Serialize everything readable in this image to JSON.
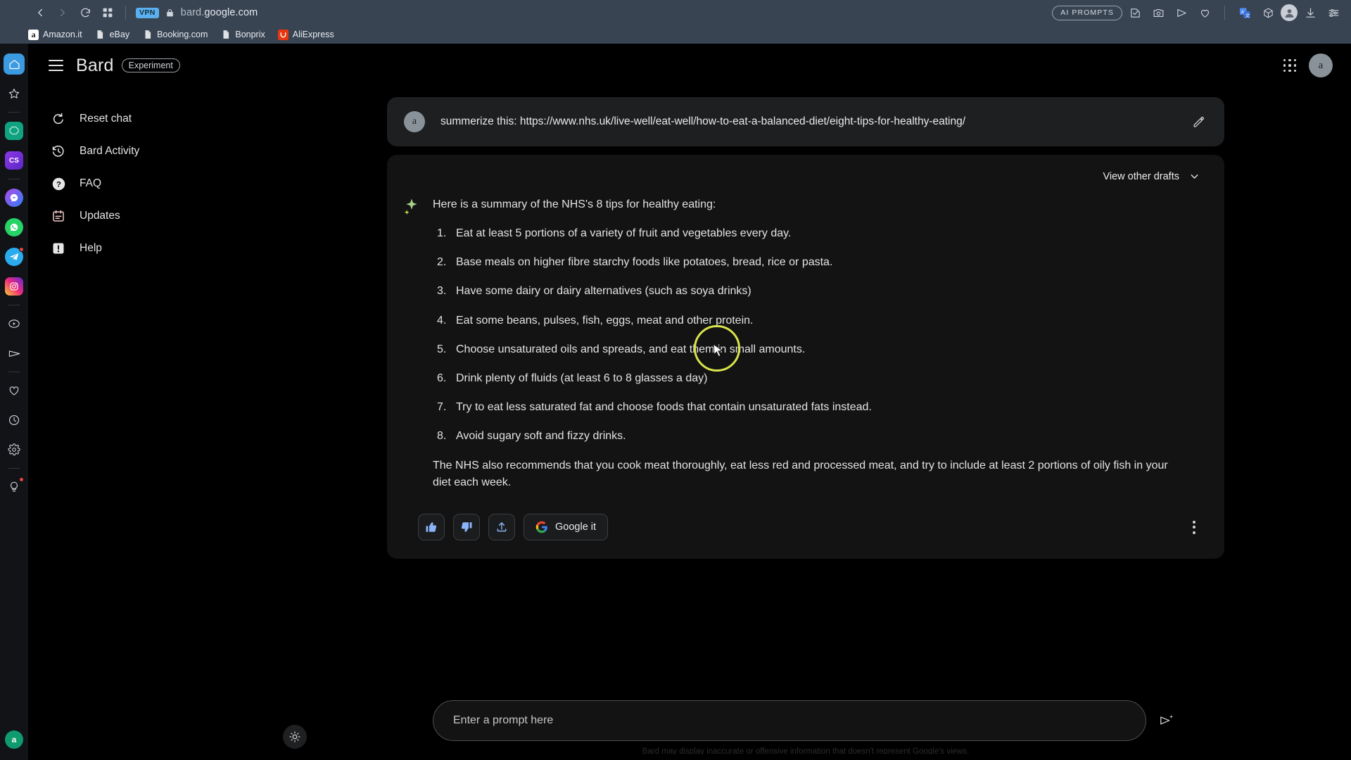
{
  "browser": {
    "back_label": "Back",
    "forward_label": "Forward",
    "reload_label": "Reload",
    "tabs_label": "Tab search",
    "vpn_badge": "VPN",
    "lock_label": "Secure",
    "url_prefix": "bard.",
    "url_main": "google.com",
    "url_full": "bard.google.com",
    "right_icons": [
      {
        "name": "ai-prompts-pill",
        "label": "AI PROMPTS"
      },
      {
        "name": "annotate-icon",
        "label": "Annotate"
      },
      {
        "name": "screenshot-icon",
        "label": "Screenshot"
      },
      {
        "name": "send-icon",
        "label": "Send"
      },
      {
        "name": "favorite-heart-icon",
        "label": "Favorite"
      },
      {
        "name": "translate-icon",
        "label": "Translate"
      },
      {
        "name": "extensions-cube-icon",
        "label": "Extensions"
      },
      {
        "name": "profile-avatar",
        "label": "Profile"
      },
      {
        "name": "download-icon",
        "label": "Downloads"
      },
      {
        "name": "settings-sliders-icon",
        "label": "Settings"
      }
    ],
    "bookmarks": [
      {
        "label": "Amazon.it",
        "icon": "amazon-icon"
      },
      {
        "label": "eBay",
        "icon": "page-icon"
      },
      {
        "label": "Booking.com",
        "icon": "page-icon"
      },
      {
        "label": "Bonprix",
        "icon": "page-icon"
      },
      {
        "label": "AliExpress",
        "icon": "aliexpress-icon"
      }
    ]
  },
  "rail": {
    "items": [
      {
        "name": "home-icon",
        "label": "Home",
        "active": true
      },
      {
        "name": "favorites-star-icon",
        "label": "Favorites"
      },
      {
        "name": "chatgpt-icon",
        "label": "ChatGPT",
        "text": ""
      },
      {
        "name": "cs-icon",
        "label": "CS",
        "text": "CS"
      },
      {
        "name": "messenger-icon",
        "label": "Messenger"
      },
      {
        "name": "whatsapp-icon",
        "label": "WhatsApp"
      },
      {
        "name": "telegram-icon",
        "label": "Telegram",
        "badge": true
      },
      {
        "name": "instagram-icon",
        "label": "Instagram"
      },
      {
        "name": "video-player-icon",
        "label": "Video"
      },
      {
        "name": "send-plane-icon",
        "label": "Send"
      },
      {
        "name": "heart-icon",
        "label": "Saved"
      },
      {
        "name": "history-clock-icon",
        "label": "History"
      },
      {
        "name": "settings-gear-icon",
        "label": "Settings"
      },
      {
        "name": "ideas-bulb-icon",
        "label": "Ideas",
        "badge": true
      },
      {
        "name": "account-a-icon",
        "label": "Account",
        "text": "a"
      }
    ]
  },
  "app": {
    "menu_label": "Main menu",
    "brand": "Bard",
    "experiment_chip": "Experiment",
    "apps_grid_label": "Google apps",
    "avatar_letter": "a",
    "nav": [
      {
        "label": "Reset chat",
        "icon": "reset-icon"
      },
      {
        "label": "Bard Activity",
        "icon": "history-icon"
      },
      {
        "label": "FAQ",
        "icon": "faq-icon"
      },
      {
        "label": "Updates",
        "icon": "calendar-icon"
      },
      {
        "label": "Help",
        "icon": "help-alert-icon"
      }
    ]
  },
  "conversation": {
    "user_avatar_letter": "a",
    "query": "summerize this: https://www.nhs.uk/live-well/eat-well/how-to-eat-a-balanced-diet/eight-tips-for-healthy-eating/",
    "edit_label": "Edit prompt",
    "drafts_label": "View other drafts",
    "answer_intro": "Here is a summary of the NHS's 8 tips for healthy eating:",
    "answer_tips": [
      "Eat at least 5 portions of a variety of fruit and vegetables every day.",
      "Base meals on higher fibre starchy foods like potatoes, bread, rice or pasta.",
      "Have some dairy or dairy alternatives (such as soya drinks)",
      "Eat some beans, pulses, fish, eggs, meat and other protein.",
      "Choose unsaturated oils and spreads, and eat them in small amounts.",
      "Drink plenty of fluids (at least 6 to 8 glasses a day)",
      "Try to eat less saturated fat and choose foods that contain unsaturated fats instead.",
      "Avoid sugary soft and fizzy drinks."
    ],
    "answer_outro": "The NHS also recommends that you cook meat thoroughly, eat less red and processed meat, and try to include at least 2 portions of oily fish in your diet each week.",
    "actions": {
      "thumbs_up_label": "Good response",
      "thumbs_down_label": "Bad response",
      "share_label": "Share & export",
      "google_it_label": "Google it",
      "more_label": "More options"
    }
  },
  "composer": {
    "placeholder": "Enter a prompt here",
    "value": "",
    "send_label": "Submit",
    "disclaimer": "Bard may display inaccurate or offensive information that doesn't represent Google's views."
  },
  "theme": {
    "toggle_label": "Use light theme",
    "accent_blue": "#8ab4f8",
    "highlight_yellow": "#d8e44a",
    "chrome_bg": "#394452",
    "app_bg": "#000000",
    "card_bg": "#1e1f20"
  }
}
